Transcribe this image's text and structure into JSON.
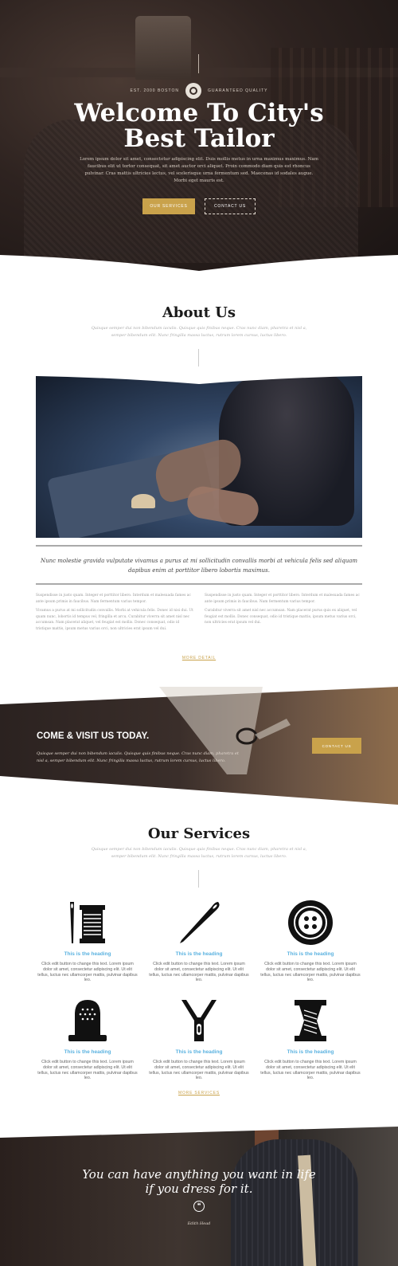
{
  "hero": {
    "badge_left": "EST. 2000 BOSTON",
    "badge_right": "GUARANTEED QUALITY",
    "title_line1": "Welcome To City's",
    "title_line2": "Best Tailor",
    "lead": "Lorem ipsum dolor sit amet, consectetur adipiscing elit. Duis mollis metus in urna maximus maximus. Nam faucibus elit ut tortor consequat, sit amet auctor orci aliquet. Proin commodo diam quis est rhoncus pulvinar. Cras mattis ultricies lectus, vel scelerisque urna fermentum sed. Maecenas id sodales augue. Morbi eget mauris est.",
    "button_services": "OUR SERVICES",
    "button_contact": "CONTACT US"
  },
  "about": {
    "title": "About Us",
    "subtitle": "Quisque semper dui non bibendum iaculis. Quisque quis finibus neque. Cras nunc diam, pharetra et nisl a, semper bibendum elit. Nunc fringilla massa luctus, rutrum lorem cursus, luctus libero.",
    "quote": "Nunc molestie gravida vulputate vivamus a purus at mi sollicitudin convallis morbi at vehicula felis sed aliquam dapibus enim at porttitor libero lobortis maximus.",
    "col1_p1": "Suspendisse in justo quam. Integer et porttitor libero. Interdum et malesuada fames ac ante ipsum primis in faucibus. Nam fermentum varius tempor.",
    "col1_p2": "Vivamus a purus at mi sollicitudin convallis. Morbi at vehicula felis. Donec id nisi dui. Ut quam nunc, lobortis id tempus vel, fringilla et arcu. Curabitur viverra sit amet nisl nec accumsan. Nam placerat aliquet, vel feugiat est mollis. Donec consequat, odio id tristique mattis, ipsum metus varius orci, non ultricies erat ipsum vel dui.",
    "col2_p1": "Suspendisse in justo quam. Integer et porttitor libero. Interdum et malesuada fames ac ante ipsum primis in faucibus. Nam fermentum varius tempor.",
    "col2_p2": "Curabitur viverra sit amet nisl nec accumsan. Nam placerat purus quis ex aliquet, vel feugiat est mollis. Donec consequat, odio id tristique mattis, ipsum metus varius orci, non ultricies erat ipsum vel dui.",
    "more": "MORE DETAIL"
  },
  "visit": {
    "title": "COME & VISIT US TODAY.",
    "text": "Quisque semper dui non bibendum iaculis. Quisque quis finibus neque. Cras nunc diam, pharetra et nisl a, semper bibendum elit. Nunc fringilla massa luctus, rutrum lorem cursus, luctus libero.",
    "button": "CONTACT US"
  },
  "services": {
    "title": "Our Services",
    "subtitle": "Quisque semper dui non bibendum iaculis. Quisque quis finibus neque. Cras nunc diam, pharetra et nisl a, semper bibendum elit. Nunc fringilla massa luctus, rutrum lorem cursus, luctus libero.",
    "items": [
      {
        "icon": "needle-and-thread-spool-icon",
        "heading": "This is the heading",
        "text": "Click edit button to change this text. Lorem ipsum dolor sit amet, consectetur adipiscing elit. Ut elit tellus, luctus nec ullamcorper mattis, pulvinar dapibus leo."
      },
      {
        "icon": "sewing-needle-icon",
        "heading": "This is the heading",
        "text": "Click edit button to change this text. Lorem ipsum dolor sit amet, consectetur adipiscing elit. Ut elit tellus, luctus nec ullamcorper mattis, pulvinar dapibus leo."
      },
      {
        "icon": "button-icon",
        "heading": "This is the heading",
        "text": "Click edit button to change this text. Lorem ipsum dolor sit amet, consectetur adipiscing elit. Ut elit tellus, luctus nec ullamcorper mattis, pulvinar dapibus leo."
      },
      {
        "icon": "thimble-icon",
        "heading": "This is the heading",
        "text": "Click edit button to change this text. Lorem ipsum dolor sit amet, consectetur adipiscing elit. Ut elit tellus, luctus nec ullamcorper mattis, pulvinar dapibus leo."
      },
      {
        "icon": "zipper-icon",
        "heading": "This is the heading",
        "text": "Click edit button to change this text. Lorem ipsum dolor sit amet, consectetur adipiscing elit. Ut elit tellus, luctus nec ullamcorper mattis, pulvinar dapibus leo."
      },
      {
        "icon": "thread-spool-icon",
        "heading": "This is the heading",
        "text": "Click edit button to change this text. Lorem ipsum dolor sit amet, consectetur adipiscing elit. Ut elit tellus, luctus nec ullamcorper mattis, pulvinar dapibus leo."
      }
    ],
    "more": "MORE SERVICES"
  },
  "testimonial": {
    "quote_line1": "You can have anything you want in life",
    "quote_line2": "if you dress for it.",
    "author": "Edith Head"
  },
  "colors": {
    "accent_gold": "#c9a24b",
    "heading_blue": "#5ab2e0",
    "hero_dark": "#2e2320"
  }
}
